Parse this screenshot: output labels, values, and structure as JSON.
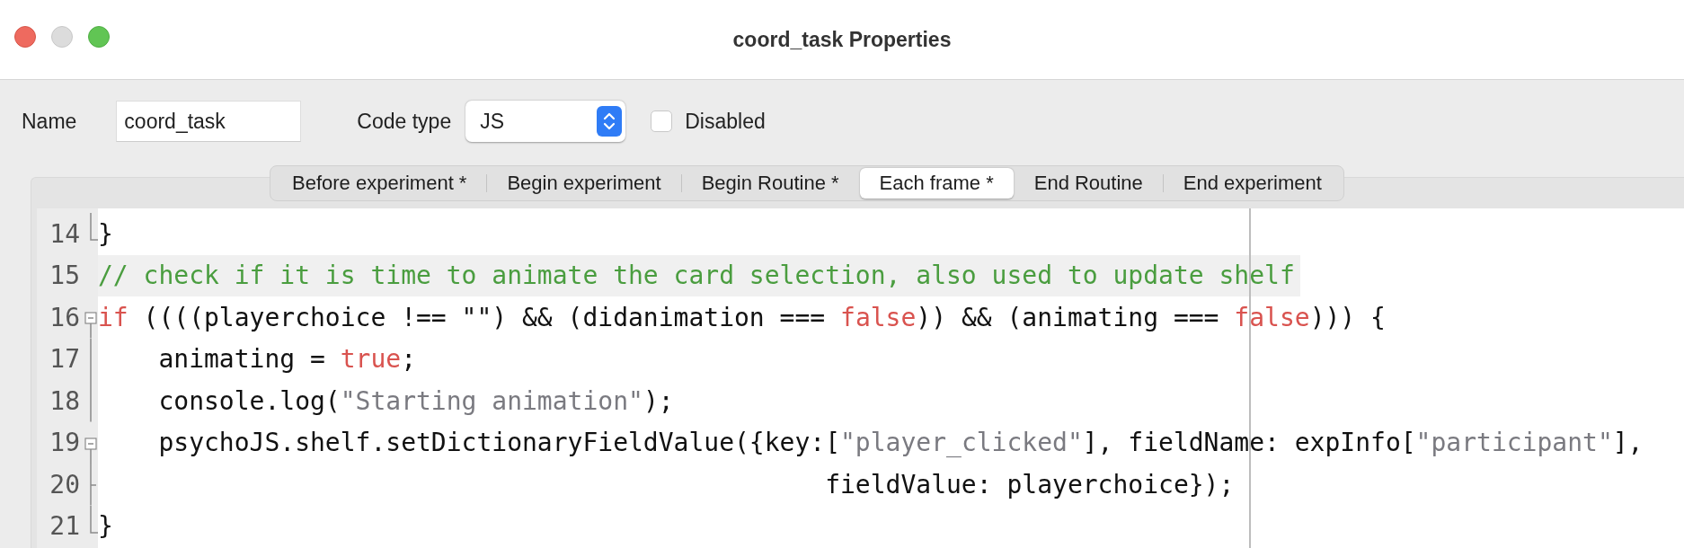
{
  "window": {
    "title": "coord_task Properties"
  },
  "form": {
    "name_label": "Name",
    "name_value": "coord_task",
    "code_type_label": "Code type",
    "code_type_value": "JS",
    "disabled": {
      "label": "Disabled",
      "checked": false
    }
  },
  "tabs": [
    {
      "label": "Before experiment *",
      "selected": false
    },
    {
      "label": "Begin experiment",
      "selected": false
    },
    {
      "label": "Begin Routine *",
      "selected": false
    },
    {
      "label": "Each frame *",
      "selected": true
    },
    {
      "label": "End Routine",
      "selected": false
    },
    {
      "label": "End experiment",
      "selected": false
    }
  ],
  "editor": {
    "lines": [
      {
        "number": "14",
        "kind": "fold_end",
        "highlighted": false,
        "tokens": [
          {
            "kind": "plain",
            "text": "}"
          }
        ]
      },
      {
        "number": "15",
        "kind": "plain",
        "highlighted": true,
        "tokens": [
          {
            "kind": "comment",
            "text": "// check if it is time to animate the card selection, also used to update shelf"
          }
        ]
      },
      {
        "number": "16",
        "kind": "fold_start",
        "highlighted": false,
        "tokens": [
          {
            "kind": "keyword",
            "text": "if"
          },
          {
            "kind": "plain",
            "text": " ((((playerchoice !== \"\") && (didanimation === "
          },
          {
            "kind": "keyword",
            "text": "false"
          },
          {
            "kind": "plain",
            "text": ")) && (animating === "
          },
          {
            "kind": "keyword",
            "text": "false"
          },
          {
            "kind": "plain",
            "text": "))) {"
          }
        ]
      },
      {
        "number": "17",
        "kind": "fold_body",
        "highlighted": false,
        "tokens": [
          {
            "kind": "plain",
            "text": "    animating = "
          },
          {
            "kind": "keyword",
            "text": "true"
          },
          {
            "kind": "plain",
            "text": ";"
          }
        ]
      },
      {
        "number": "18",
        "kind": "fold_body",
        "highlighted": false,
        "tokens": [
          {
            "kind": "plain",
            "text": "    console.log("
          },
          {
            "kind": "string",
            "text": "\"Starting animation\""
          },
          {
            "kind": "plain",
            "text": ");"
          }
        ]
      },
      {
        "number": "19",
        "kind": "fold_start",
        "highlighted": false,
        "tokens": [
          {
            "kind": "plain",
            "text": "    psychoJS.shelf.setDictionaryFieldValue({key:["
          },
          {
            "kind": "string",
            "text": "\"player_clicked\""
          },
          {
            "kind": "plain",
            "text": "], fieldName: expInfo["
          },
          {
            "kind": "string",
            "text": "\"participant\""
          },
          {
            "kind": "plain",
            "text": "],"
          }
        ]
      },
      {
        "number": "20",
        "kind": "fold_branch",
        "highlighted": false,
        "tokens": [
          {
            "kind": "plain",
            "text": "                                                fieldValue: playerchoice});"
          }
        ]
      },
      {
        "number": "21",
        "kind": "fold_end",
        "highlighted": false,
        "tokens": [
          {
            "kind": "plain",
            "text": "}"
          }
        ]
      }
    ]
  }
}
